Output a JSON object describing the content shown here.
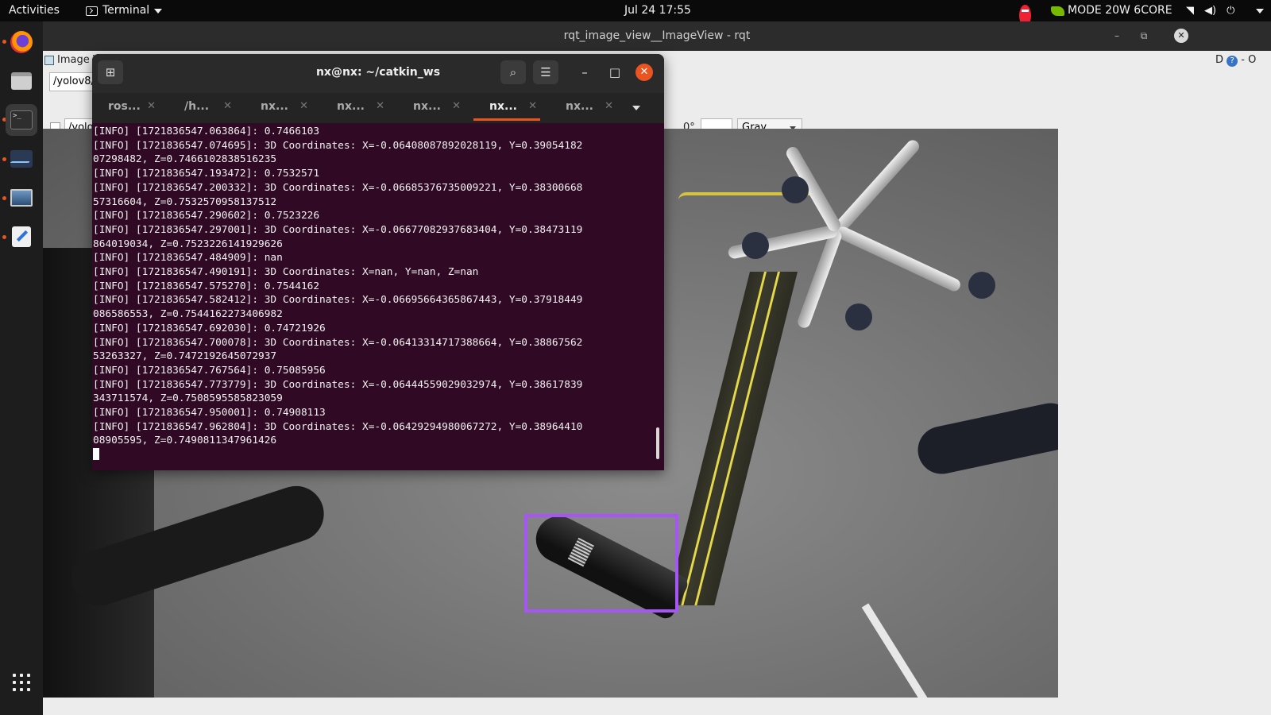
{
  "topbar": {
    "activities": "Activities",
    "app_menu": "Terminal",
    "clock": "Jul 24  17:55",
    "power_mode": "MODE 20W 6CORE"
  },
  "dock": {
    "items": [
      "firefox-icon",
      "files-icon",
      "terminal-icon",
      "system-monitor-icon",
      "image-viewer-icon",
      "text-editor-icon"
    ],
    "active": "terminal-icon"
  },
  "rqt": {
    "title": "rqt_image_view__ImageView - rqt",
    "plugin_tab": "Image V",
    "dock_controls": "D",
    "topic_value": "/yolov8/",
    "topic_field": "/yolo",
    "rotation": "0°",
    "color_scheme": "Gray"
  },
  "terminal": {
    "title": "nx@nx: ~/catkin_ws",
    "tabs": [
      {
        "label": "ros..."
      },
      {
        "label": "/h..."
      },
      {
        "label": "nx..."
      },
      {
        "label": "nx..."
      },
      {
        "label": "nx..."
      },
      {
        "label": "nx..."
      },
      {
        "label": "nx..."
      }
    ],
    "active_tab": 5,
    "lines": [
      "[INFO] [1721836547.063864]: 0.7466103",
      "[INFO] [1721836547.074695]: 3D Coordinates: X=-0.06408087892028119, Y=0.39054182",
      "07298482, Z=0.7466102838516235",
      "[INFO] [1721836547.193472]: 0.7532571",
      "[INFO] [1721836547.200332]: 3D Coordinates: X=-0.06685376735009221, Y=0.38300668",
      "57316604, Z=0.7532570958137512",
      "[INFO] [1721836547.290602]: 0.7523226",
      "[INFO] [1721836547.297001]: 3D Coordinates: X=-0.06677082937683404, Y=0.38473119",
      "864019034, Z=0.7523226141929626",
      "[INFO] [1721836547.484909]: nan",
      "[INFO] [1721836547.490191]: 3D Coordinates: X=nan, Y=nan, Z=nan",
      "[INFO] [1721836547.575270]: 0.7544162",
      "[INFO] [1721836547.582412]: 3D Coordinates: X=-0.06695664365867443, Y=0.37918449",
      "086586553, Z=0.7544162273406982",
      "[INFO] [1721836547.692030]: 0.74721926",
      "[INFO] [1721836547.700078]: 3D Coordinates: X=-0.06413314717388664, Y=0.38867562",
      "53263327, Z=0.7472192645072937",
      "[INFO] [1721836547.767564]: 0.75085956",
      "[INFO] [1721836547.773779]: 3D Coordinates: X=-0.06444559029032974, Y=0.38617839",
      "343711574, Z=0.7508595585823059",
      "[INFO] [1721836547.950001]: 0.74908113",
      "[INFO] [1721836547.962804]: 3D Coordinates: X=-0.06429294980067272, Y=0.38964410",
      "08905595, Z=0.7490811347961426"
    ]
  },
  "colors": {
    "terminal_bg": "#300a24",
    "accent": "#e95420",
    "detection_box": "#a855f7"
  }
}
